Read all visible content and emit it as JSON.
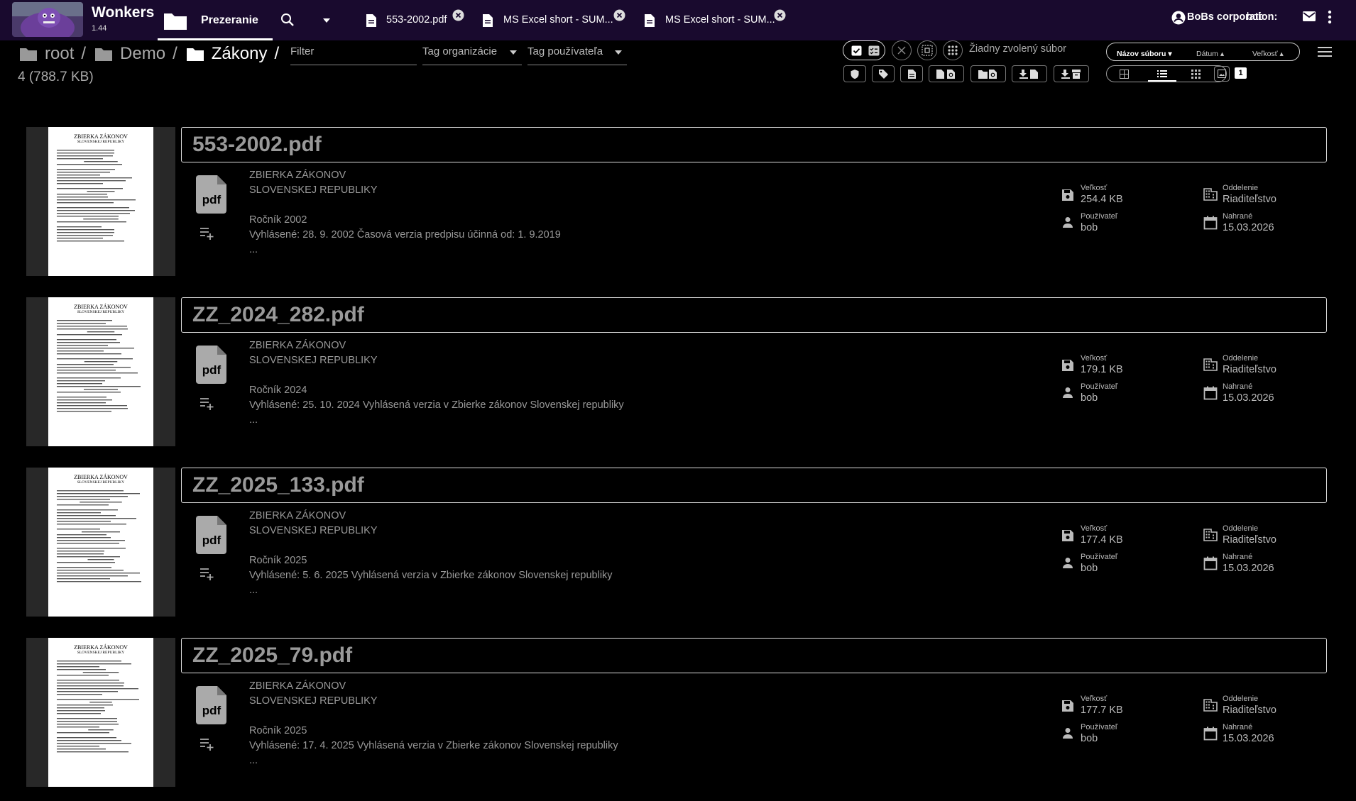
{
  "app": {
    "name": "Wonkers",
    "version": "1.44"
  },
  "topbar": {
    "browse_tab": "Prezeranie",
    "open_tabs": [
      {
        "label": "553-2002.pdf"
      },
      {
        "label": "MS Excel short - SUM..."
      },
      {
        "label": "MS Excel short - SUM..."
      }
    ],
    "org": "BoBs corporation:",
    "user": "bob"
  },
  "breadcrumb": [
    "root",
    "Demo",
    "Zákony"
  ],
  "summary": "4 (788.7 KB)",
  "filters": {
    "filter_placeholder": "Filter",
    "org_tag": "Tag organizácie",
    "user_tag": "Tag používateľa"
  },
  "selection": {
    "status": "Žiadny zvolený súbor"
  },
  "sort": {
    "name": "Názov súboru",
    "date": "Dátum",
    "size": "Veľkosť"
  },
  "page_badge": "1",
  "meta_labels": {
    "size": "Veľkosť",
    "user": "Používateľ",
    "dept": "Oddelenie",
    "uploaded": "Nahrané"
  },
  "files": [
    {
      "name": "553-2002.pdf",
      "line1": "ZBIERKA ZÁKONOV",
      "line2": "SLOVENSKEJ REPUBLIKY",
      "line3": "Ročník 2002",
      "line4": "Vyhlásené: 28. 9. 2002 Časová verzia predpisu účinná od: 1. 9.2019",
      "ellipsis": "...",
      "size": "254.4 KB",
      "user": "bob",
      "dept": "Riaditeľstvo",
      "uploaded": "15.03.2026"
    },
    {
      "name": "ZZ_2024_282.pdf",
      "line1": "ZBIERKA ZÁKONOV",
      "line2": "SLOVENSKEJ REPUBLIKY",
      "line3": "Ročník 2024",
      "line4": "Vyhlásené: 25. 10. 2024 Vyhlásená verzia v Zbierke zákonov Slovenskej republiky",
      "ellipsis": "...",
      "size": "179.1 KB",
      "user": "bob",
      "dept": "Riaditeľstvo",
      "uploaded": "15.03.2026"
    },
    {
      "name": "ZZ_2025_133.pdf",
      "line1": "ZBIERKA ZÁKONOV",
      "line2": "SLOVENSKEJ REPUBLIKY",
      "line3": "Ročník 2025",
      "line4": "Vyhlásené: 5. 6. 2025 Vyhlásená verzia v Zbierke zákonov Slovenskej republiky",
      "ellipsis": "...",
      "size": "177.4 KB",
      "user": "bob",
      "dept": "Riaditeľstvo",
      "uploaded": "15.03.2026"
    },
    {
      "name": "ZZ_2025_79.pdf",
      "line1": "ZBIERKA ZÁKONOV",
      "line2": "SLOVENSKEJ REPUBLIKY",
      "line3": "Ročník 2025",
      "line4": "Vyhlásené: 17. 4. 2025 Vyhlásená verzia v Zbierke zákonov Slovenskej republiky",
      "ellipsis": "...",
      "size": "177.7 KB",
      "user": "bob",
      "dept": "Riaditeľstvo",
      "uploaded": "15.03.2026"
    }
  ],
  "thumb_text": {
    "t1": "ZBIERKA ZÁKONOV",
    "t2": "SLOVENSKEJ REPUBLIKY"
  },
  "icons": {
    "file_type": "pdf"
  },
  "colors": {
    "topbar": "#190a2e",
    "background": "#000000"
  }
}
